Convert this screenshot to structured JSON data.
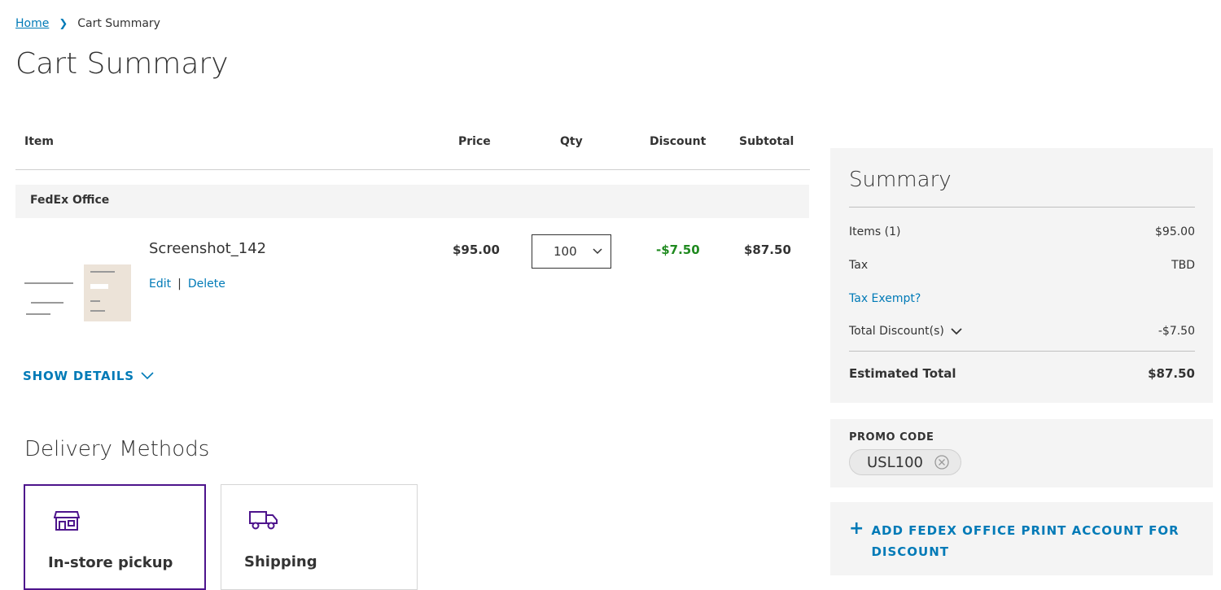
{
  "breadcrumb": {
    "home": "Home",
    "current": "Cart Summary"
  },
  "page_title": "Cart Summary",
  "table": {
    "headers": {
      "item": "Item",
      "price": "Price",
      "qty": "Qty",
      "discount": "Discount",
      "subtotal": "Subtotal"
    },
    "vendor": "FedEx Office",
    "row": {
      "name": "Screenshot_142",
      "edit": "Edit",
      "separator": "|",
      "delete": "Delete",
      "price": "$95.00",
      "qty": "100",
      "discount": "-$7.50",
      "subtotal": "$87.50"
    },
    "show_details": "SHOW DETAILS"
  },
  "delivery": {
    "title": "Delivery Methods",
    "options": [
      {
        "label": "In-store pickup",
        "icon": "store-icon",
        "selected": true
      },
      {
        "label": "Shipping",
        "icon": "truck-icon",
        "selected": false
      }
    ]
  },
  "summary": {
    "title": "Summary",
    "items_label": "Items (1)",
    "items_value": "$95.00",
    "tax_label": "Tax",
    "tax_value": "TBD",
    "tax_exempt": "Tax Exempt?",
    "discount_label": "Total Discount(s)",
    "discount_value": "-$7.50",
    "total_label": "Estimated Total",
    "total_value": "$87.50"
  },
  "promo": {
    "label": "PROMO CODE",
    "code": "USL100"
  },
  "add_account": {
    "line1": "ADD FEDEX OFFICE PRINT ACCOUNT FOR",
    "line2": "DISCOUNT"
  },
  "colors": {
    "link": "#007ab7",
    "discount": "#1f8a1f",
    "brand_purple": "#4d148c",
    "panel_bg": "#f4f4f4"
  }
}
